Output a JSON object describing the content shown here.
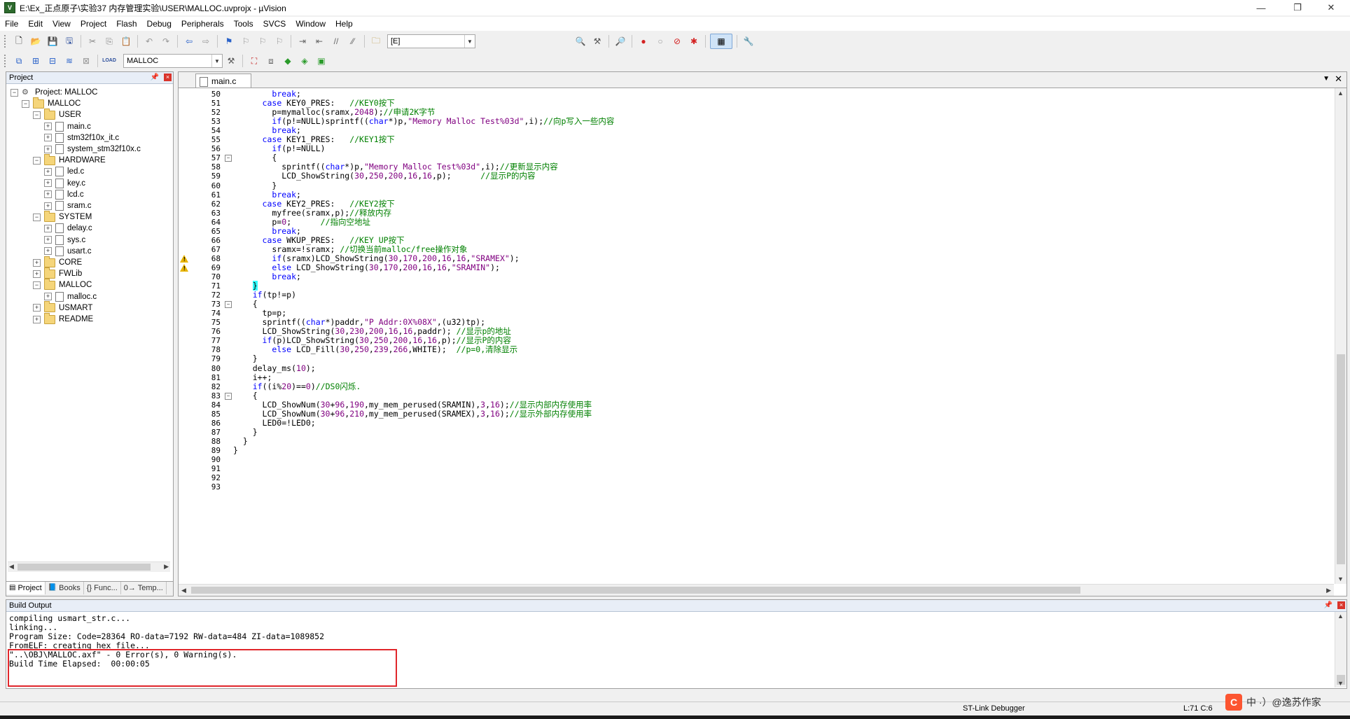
{
  "window": {
    "title": "E:\\Ex_正点原子\\实验37 内存管理实验\\USER\\MALLOC.uvprojx - µVision",
    "minimize": "—",
    "maximize": "❐",
    "close": "✕"
  },
  "menu": [
    "File",
    "Edit",
    "View",
    "Project",
    "Flash",
    "Debug",
    "Peripherals",
    "Tools",
    "SVCS",
    "Window",
    "Help"
  ],
  "toolbar1": {
    "find_combo": "[E]"
  },
  "toolbar2": {
    "load_label": "LOAD",
    "target_combo": "MALLOC"
  },
  "project_panel": {
    "title": "Project",
    "tree": [
      {
        "label": "Project: MALLOC",
        "level": 0,
        "type": "project",
        "exp": "-"
      },
      {
        "label": "MALLOC",
        "level": 1,
        "type": "folder",
        "exp": "-"
      },
      {
        "label": "USER",
        "level": 2,
        "type": "folder",
        "exp": "-"
      },
      {
        "label": "main.c",
        "level": 3,
        "type": "file",
        "exp": "+"
      },
      {
        "label": "stm32f10x_it.c",
        "level": 3,
        "type": "file",
        "exp": "+"
      },
      {
        "label": "system_stm32f10x.c",
        "level": 3,
        "type": "file",
        "exp": "+"
      },
      {
        "label": "HARDWARE",
        "level": 2,
        "type": "folder",
        "exp": "-"
      },
      {
        "label": "led.c",
        "level": 3,
        "type": "file",
        "exp": "+"
      },
      {
        "label": "key.c",
        "level": 3,
        "type": "file",
        "exp": "+"
      },
      {
        "label": "lcd.c",
        "level": 3,
        "type": "file",
        "exp": "+"
      },
      {
        "label": "sram.c",
        "level": 3,
        "type": "file",
        "exp": "+"
      },
      {
        "label": "SYSTEM",
        "level": 2,
        "type": "folder",
        "exp": "-"
      },
      {
        "label": "delay.c",
        "level": 3,
        "type": "file",
        "exp": "+"
      },
      {
        "label": "sys.c",
        "level": 3,
        "type": "file",
        "exp": "+"
      },
      {
        "label": "usart.c",
        "level": 3,
        "type": "file",
        "exp": "+"
      },
      {
        "label": "CORE",
        "level": 2,
        "type": "folder",
        "exp": "+"
      },
      {
        "label": "FWLib",
        "level": 2,
        "type": "folder",
        "exp": "+"
      },
      {
        "label": "MALLOC",
        "level": 2,
        "type": "folder",
        "exp": "-"
      },
      {
        "label": "malloc.c",
        "level": 3,
        "type": "file",
        "exp": "+"
      },
      {
        "label": "USMART",
        "level": 2,
        "type": "folder",
        "exp": "+"
      },
      {
        "label": "README",
        "level": 2,
        "type": "folder",
        "exp": "+"
      }
    ],
    "tabs": [
      "Project",
      "Books",
      "{} Func...",
      "0→ Temp..."
    ]
  },
  "editor": {
    "tab": "main.c",
    "lines": [
      {
        "n": "50",
        "segs": [
          [
            "        ",
            ""
          ],
          [
            "break",
            ""
          ],
          [
            ";",
            ""
          ]
        ],
        "raw": "        break;"
      },
      {
        "n": "51"
      },
      {
        "n": "52"
      },
      {
        "n": "53"
      },
      {
        "n": "54"
      },
      {
        "n": "55"
      },
      {
        "n": "56"
      },
      {
        "n": "57"
      },
      {
        "n": "58"
      },
      {
        "n": "59"
      },
      {
        "n": "60"
      },
      {
        "n": "61"
      },
      {
        "n": "62"
      },
      {
        "n": "63"
      },
      {
        "n": "64"
      },
      {
        "n": "65"
      },
      {
        "n": "66"
      },
      {
        "n": "67"
      },
      {
        "n": "68"
      },
      {
        "n": "69"
      },
      {
        "n": "70"
      },
      {
        "n": "71"
      },
      {
        "n": "72"
      },
      {
        "n": "73"
      },
      {
        "n": "74"
      },
      {
        "n": "75"
      },
      {
        "n": "76"
      },
      {
        "n": "77"
      },
      {
        "n": "78"
      },
      {
        "n": "79"
      },
      {
        "n": "80"
      },
      {
        "n": "81"
      },
      {
        "n": "82"
      },
      {
        "n": "83"
      },
      {
        "n": "84"
      },
      {
        "n": "85"
      },
      {
        "n": "86"
      },
      {
        "n": "87"
      },
      {
        "n": "88"
      },
      {
        "n": "89"
      },
      {
        "n": "90"
      },
      {
        "n": "91"
      },
      {
        "n": "92"
      },
      {
        "n": "93"
      }
    ],
    "code": [
      [
        [
          "        ",
          ""
        ],
        [
          "break",
          "kw"
        ],
        [
          ";",
          ""
        ]
      ],
      [
        [
          "      ",
          ""
        ],
        [
          "case",
          "kw"
        ],
        [
          " KEY0_PRES:   ",
          ""
        ],
        [
          "//KEY0按下",
          "cm"
        ]
      ],
      [
        [
          "        p=mymalloc(sramx,",
          ""
        ],
        [
          "2048",
          "num"
        ],
        [
          ");",
          ""
        ],
        [
          "//申请2K字节",
          "cm"
        ]
      ],
      [
        [
          "        ",
          ""
        ],
        [
          "if",
          "kw"
        ],
        [
          "(p!=NULL)sprintf((",
          ""
        ],
        [
          "char",
          "kw"
        ],
        [
          "*)p,",
          ""
        ],
        [
          "\"Memory Malloc Test%03d\"",
          "str"
        ],
        [
          ",i);",
          ""
        ],
        [
          "//向p写入一些内容",
          "cm"
        ]
      ],
      [
        [
          "        ",
          ""
        ],
        [
          "break",
          "kw"
        ],
        [
          ";",
          ""
        ]
      ],
      [
        [
          "      ",
          ""
        ],
        [
          "case",
          "kw"
        ],
        [
          " KEY1_PRES:   ",
          ""
        ],
        [
          "//KEY1按下",
          "cm"
        ]
      ],
      [
        [
          "        ",
          ""
        ],
        [
          "if",
          "kw"
        ],
        [
          "(p!=NULL)",
          ""
        ]
      ],
      [
        [
          "        {",
          ""
        ]
      ],
      [
        [
          "          sprintf((",
          ""
        ],
        [
          "char",
          "kw"
        ],
        [
          "*)p,",
          ""
        ],
        [
          "\"Memory Malloc Test%03d\"",
          "str"
        ],
        [
          ",i);",
          ""
        ],
        [
          "//更新显示内容",
          "cm"
        ]
      ],
      [
        [
          "          LCD_ShowString(",
          ""
        ],
        [
          "30",
          "num"
        ],
        [
          ",",
          ""
        ],
        [
          "250",
          "num"
        ],
        [
          ",",
          ""
        ],
        [
          "200",
          "num"
        ],
        [
          ",",
          ""
        ],
        [
          "16",
          "num"
        ],
        [
          ",",
          ""
        ],
        [
          "16",
          "num"
        ],
        [
          ",p);      ",
          ""
        ],
        [
          "//显示P的内容",
          "cm"
        ]
      ],
      [
        [
          "        }",
          ""
        ]
      ],
      [
        [
          "        ",
          ""
        ],
        [
          "break",
          "kw"
        ],
        [
          ";",
          ""
        ]
      ],
      [
        [
          "      ",
          ""
        ],
        [
          "case",
          "kw"
        ],
        [
          " KEY2_PRES:   ",
          ""
        ],
        [
          "//KEY2按下",
          "cm"
        ]
      ],
      [
        [
          "        myfree(sramx,p);",
          ""
        ],
        [
          "//释放内存",
          "cm"
        ]
      ],
      [
        [
          "        p=",
          ""
        ],
        [
          "0",
          "num"
        ],
        [
          ";      ",
          ""
        ],
        [
          "//指向空地址",
          "cm"
        ]
      ],
      [
        [
          "        ",
          ""
        ],
        [
          "break",
          "kw"
        ],
        [
          ";",
          ""
        ]
      ],
      [
        [
          "      ",
          ""
        ],
        [
          "case",
          "kw"
        ],
        [
          " WKUP_PRES:   ",
          ""
        ],
        [
          "//KEY UP按下",
          "cm"
        ]
      ],
      [
        [
          "        sramx=!sramx; ",
          ""
        ],
        [
          "//切换当前malloc/free操作对象",
          "cm"
        ]
      ],
      [
        [
          "        ",
          ""
        ],
        [
          "if",
          "kw"
        ],
        [
          "(sramx)LCD_ShowString(",
          ""
        ],
        [
          "30",
          "num"
        ],
        [
          ",",
          ""
        ],
        [
          "170",
          "num"
        ],
        [
          ",",
          ""
        ],
        [
          "200",
          "num"
        ],
        [
          ",",
          ""
        ],
        [
          "16",
          "num"
        ],
        [
          ",",
          ""
        ],
        [
          "16",
          "num"
        ],
        [
          ",",
          ""
        ],
        [
          "\"SRAMEX\"",
          "str"
        ],
        [
          ");",
          ""
        ]
      ],
      [
        [
          "        ",
          ""
        ],
        [
          "else",
          "kw"
        ],
        [
          " LCD_ShowString(",
          ""
        ],
        [
          "30",
          "num"
        ],
        [
          ",",
          ""
        ],
        [
          "170",
          "num"
        ],
        [
          ",",
          ""
        ],
        [
          "200",
          "num"
        ],
        [
          ",",
          ""
        ],
        [
          "16",
          "num"
        ],
        [
          ",",
          ""
        ],
        [
          "16",
          "num"
        ],
        [
          ",",
          ""
        ],
        [
          "\"SRAMIN\"",
          "str"
        ],
        [
          ");",
          ""
        ]
      ],
      [
        [
          "        ",
          ""
        ],
        [
          "break",
          "kw"
        ],
        [
          ";",
          ""
        ]
      ],
      [
        [
          "    ",
          ""
        ],
        [
          "}",
          "hl"
        ]
      ],
      [
        [
          "    ",
          ""
        ],
        [
          "if",
          "kw"
        ],
        [
          "(tp!=p)",
          ""
        ]
      ],
      [
        [
          "    {",
          ""
        ]
      ],
      [
        [
          "      tp=p;",
          ""
        ]
      ],
      [
        [
          "      sprintf((",
          ""
        ],
        [
          "char",
          "kw"
        ],
        [
          "*)paddr,",
          ""
        ],
        [
          "\"P Addr:0X%08X\"",
          "str"
        ],
        [
          ",(u32)tp);",
          ""
        ]
      ],
      [
        [
          "      LCD_ShowString(",
          ""
        ],
        [
          "30",
          "num"
        ],
        [
          ",",
          ""
        ],
        [
          "230",
          "num"
        ],
        [
          ",",
          ""
        ],
        [
          "200",
          "num"
        ],
        [
          ",",
          ""
        ],
        [
          "16",
          "num"
        ],
        [
          ",",
          ""
        ],
        [
          "16",
          "num"
        ],
        [
          ",paddr); ",
          ""
        ],
        [
          "//显示p的地址",
          "cm"
        ]
      ],
      [
        [
          "      ",
          ""
        ],
        [
          "if",
          "kw"
        ],
        [
          "(p)LCD_ShowString(",
          ""
        ],
        [
          "30",
          "num"
        ],
        [
          ",",
          ""
        ],
        [
          "250",
          "num"
        ],
        [
          ",",
          ""
        ],
        [
          "200",
          "num"
        ],
        [
          ",",
          ""
        ],
        [
          "16",
          "num"
        ],
        [
          ",",
          ""
        ],
        [
          "16",
          "num"
        ],
        [
          ",p);",
          ""
        ],
        [
          "//显示P的内容",
          "cm"
        ]
      ],
      [
        [
          "        ",
          ""
        ],
        [
          "else",
          "kw"
        ],
        [
          " LCD_Fill(",
          ""
        ],
        [
          "30",
          "num"
        ],
        [
          ",",
          ""
        ],
        [
          "250",
          "num"
        ],
        [
          ",",
          ""
        ],
        [
          "239",
          "num"
        ],
        [
          ",",
          ""
        ],
        [
          "266",
          "num"
        ],
        [
          ",WHITE);  ",
          ""
        ],
        [
          "//p=0,清除显示",
          "cm"
        ]
      ],
      [
        [
          "    }",
          ""
        ]
      ],
      [
        [
          "    delay_ms(",
          ""
        ],
        [
          "10",
          "num"
        ],
        [
          ");",
          ""
        ]
      ],
      [
        [
          "    i++;",
          ""
        ]
      ],
      [
        [
          "    ",
          ""
        ],
        [
          "if",
          "kw"
        ],
        [
          "((i%",
          ""
        ],
        [
          "20",
          "num"
        ],
        [
          ")==",
          ""
        ],
        [
          "0",
          "num"
        ],
        [
          ")",
          ""
        ],
        [
          "//DS0闪烁.",
          "cm"
        ]
      ],
      [
        [
          "    {",
          ""
        ]
      ],
      [
        [
          "      LCD_ShowNum(",
          ""
        ],
        [
          "30",
          "num"
        ],
        [
          "+",
          ""
        ],
        [
          "96",
          "num"
        ],
        [
          ",",
          ""
        ],
        [
          "190",
          "num"
        ],
        [
          ",my_mem_perused(SRAMIN),",
          ""
        ],
        [
          "3",
          "num"
        ],
        [
          ",",
          ""
        ],
        [
          "16",
          "num"
        ],
        [
          ");",
          ""
        ],
        [
          "//显示内部内存使用率",
          "cm"
        ]
      ],
      [
        [
          "      LCD_ShowNum(",
          ""
        ],
        [
          "30",
          "num"
        ],
        [
          "+",
          ""
        ],
        [
          "96",
          "num"
        ],
        [
          ",",
          ""
        ],
        [
          "210",
          "num"
        ],
        [
          ",my_mem_perused(SRAMEX),",
          ""
        ],
        [
          "3",
          "num"
        ],
        [
          ",",
          ""
        ],
        [
          "16",
          "num"
        ],
        [
          ");",
          ""
        ],
        [
          "//显示外部内存使用率",
          "cm"
        ]
      ],
      [
        [
          "      LED0=!LED0;",
          ""
        ]
      ],
      [
        [
          "    }",
          ""
        ]
      ],
      [
        [
          "  }",
          ""
        ]
      ],
      [
        [
          "}",
          ""
        ]
      ],
      [
        [
          "",
          ""
        ]
      ],
      [
        [
          "",
          ""
        ]
      ],
      [
        [
          "",
          ""
        ]
      ],
      [
        [
          "",
          ""
        ]
      ]
    ],
    "warnings_at": [
      "68",
      "69"
    ],
    "folds_at": [
      "57",
      "73",
      "83"
    ]
  },
  "build_output": {
    "title": "Build Output",
    "lines": [
      "compiling usmart_str.c...",
      "linking...",
      "Program Size: Code=28364 RO-data=7192 RW-data=484 ZI-data=1089852",
      "FromELF: creating hex file...",
      "\"..\\OBJ\\MALLOC.axf\" - 0 Error(s), 0 Warning(s).",
      "Build Time Elapsed:  00:00:05"
    ]
  },
  "statusbar": {
    "debugger": "ST-Link Debugger",
    "position": "L:71 C:6"
  },
  "watermark": {
    "logo": "C",
    "text": "中 ·）@逸苏作家"
  },
  "colors": {
    "keyword": "#0000ff",
    "number": "#800080",
    "comment": "#008000",
    "highlight_brace": "#33ffff",
    "redbox": "#e0262b"
  }
}
